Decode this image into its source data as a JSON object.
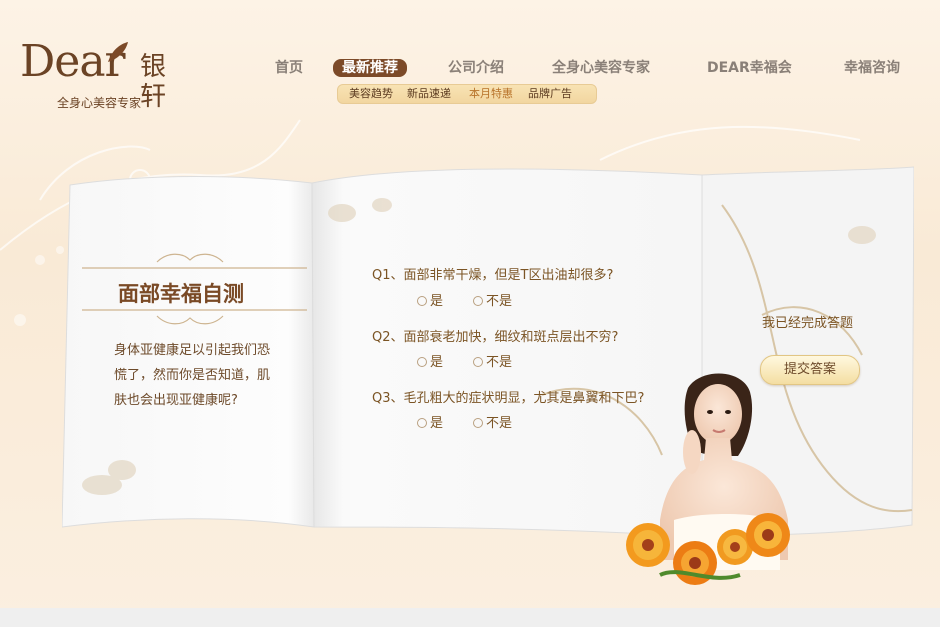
{
  "brand": {
    "logo_text": "Dear",
    "logo_cn": "银轩",
    "tagline": "全身心美容专家"
  },
  "nav": {
    "items": [
      {
        "label": "首页"
      },
      {
        "label": "最新推荐"
      },
      {
        "label": "公司介绍"
      },
      {
        "label": "全身心美容专家"
      },
      {
        "label": "DEAR幸福会"
      },
      {
        "label": "幸福咨询"
      }
    ],
    "active_index": 1,
    "subnav": [
      {
        "label": "美容趋势"
      },
      {
        "label": "新品速递"
      },
      {
        "label": "本月特惠"
      },
      {
        "label": "品牌广告"
      }
    ]
  },
  "quiz": {
    "title": "面部幸福自测",
    "intro": "身体亚健康足以引起我们恐慌了，然而你是否知道，肌肤也会出现亚健康呢?",
    "questions": [
      {
        "text": "Q1、面部非常干燥，但是T区出油却很多?",
        "yes": "是",
        "no": "不是"
      },
      {
        "text": "Q2、面部衰老加快，细纹和斑点层出不穷?",
        "yes": "是",
        "no": "不是"
      },
      {
        "text": "Q3、毛孔粗大的症状明显，尤其是鼻翼和下巴?",
        "yes": "是",
        "no": "不是"
      }
    ],
    "done_label": "我已经完成答题",
    "submit_label": "提交答案"
  },
  "colors": {
    "brand_brown": "#7c4a28",
    "accent_gold": "#f4dea2",
    "text_brown": "#7b5424"
  }
}
